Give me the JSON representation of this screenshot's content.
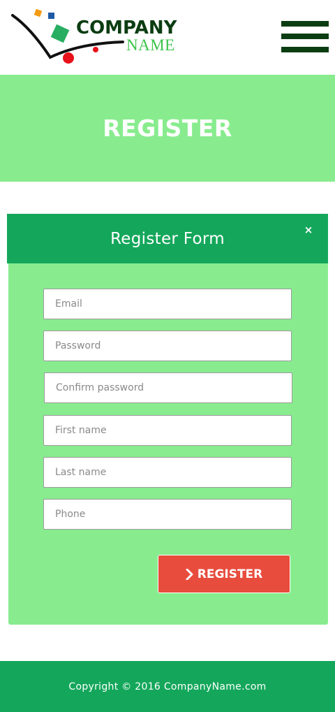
{
  "header": {
    "logo": {
      "line1": "COMPANY",
      "line2": "NAME"
    },
    "menu_icon": "hamburger-icon"
  },
  "banner": {
    "title": "REGISTER"
  },
  "form": {
    "title": "Register Form",
    "close_label": "×",
    "fields": {
      "email": {
        "placeholder": "Email",
        "value": ""
      },
      "password": {
        "placeholder": "Password",
        "value": ""
      },
      "confirm_password": {
        "placeholder": "Confirm password",
        "value": ""
      },
      "first_name": {
        "placeholder": "First name",
        "value": ""
      },
      "last_name": {
        "placeholder": "Last name",
        "value": ""
      },
      "phone": {
        "placeholder": "Phone",
        "value": ""
      }
    },
    "submit_label": "REGISTER",
    "submit_icon": "chevron-right-icon"
  },
  "footer": {
    "copyright": "Copyright © 2016 CompanyName.com"
  },
  "colors": {
    "header_bg": "#ffffff",
    "logo_dark_green": "#0b3d12",
    "logo_light_green": "#3cc44b",
    "banner_bg": "#88ec8e",
    "panel_head_bg": "#14a75b",
    "panel_body_bg": "#88ec8e",
    "button_bg": "#e84c3d",
    "footer_bg": "#14a75b"
  }
}
